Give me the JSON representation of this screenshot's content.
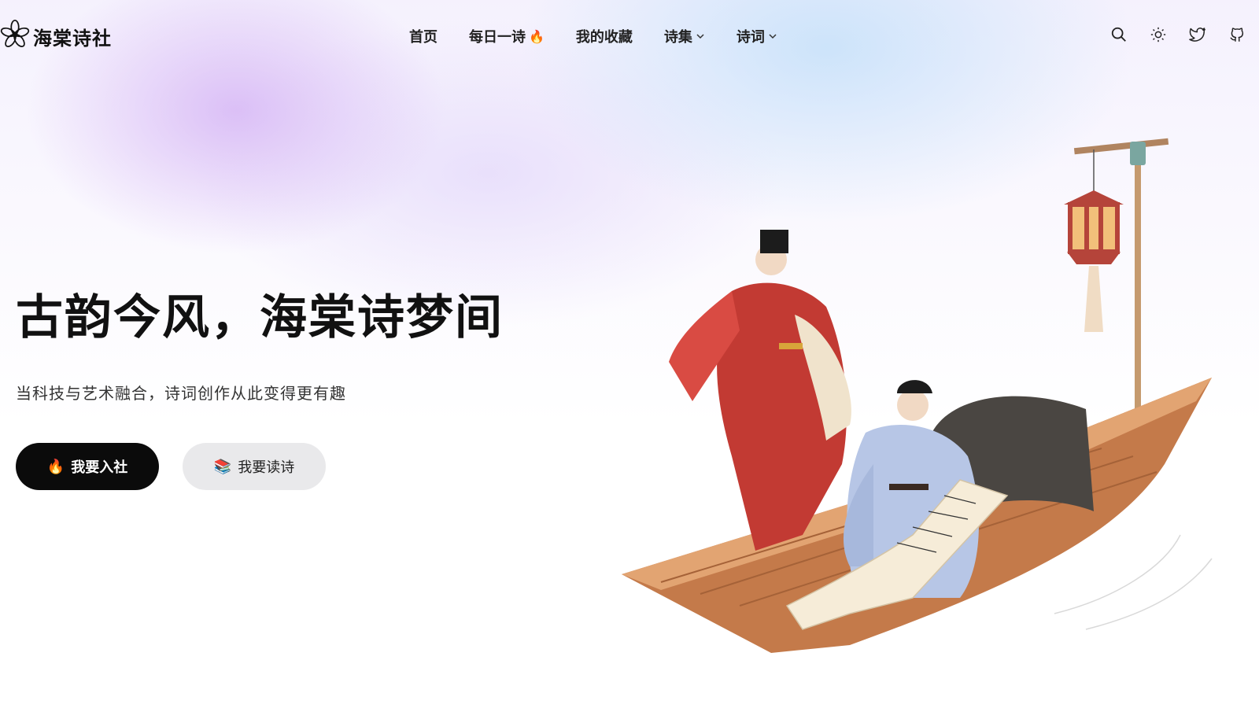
{
  "brand": {
    "name": "海棠诗社",
    "logo_icon": "flower-icon"
  },
  "nav": {
    "items": [
      {
        "label": "首页",
        "suffix": ""
      },
      {
        "label": "每日一诗",
        "suffix": "🔥"
      },
      {
        "label": "我的收藏",
        "suffix": ""
      },
      {
        "label": "诗集",
        "suffix": "⌄"
      },
      {
        "label": "诗词",
        "suffix": "⌄"
      }
    ]
  },
  "header_icons": [
    "search-icon",
    "sun-icon",
    "twitter-icon",
    "github-icon"
  ],
  "hero": {
    "title": "古韵今风，海棠诗梦间",
    "subtitle": "当科技与艺术融合，诗词创作从此变得更有趣",
    "primary_button": {
      "emoji": "🔥",
      "label": "我要入社"
    },
    "secondary_button": {
      "emoji": "📚",
      "label": "我要读诗"
    }
  },
  "colors": {
    "primary_button_bg": "#0b0b0b",
    "secondary_button_bg": "#e9e9eb",
    "accent_flame": "#f26b1d"
  }
}
